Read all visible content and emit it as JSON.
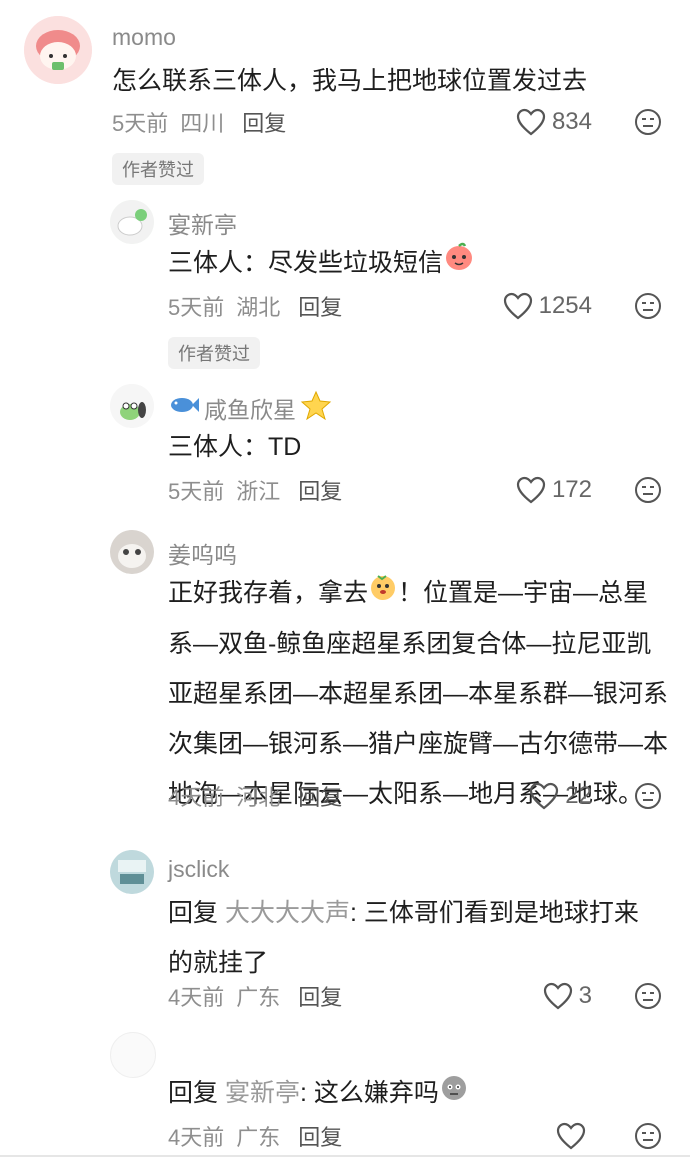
{
  "comments": [
    {
      "username": "momo",
      "text": "怎么联系三体人，我马上把地球位置发过去",
      "time": "5天前",
      "location": "四川",
      "reply_label": "回复",
      "likes": "834",
      "badge": "作者赞过"
    },
    {
      "username": "宴新亭",
      "text": "三体人：尽发些垃圾短信",
      "time": "5天前",
      "location": "湖北",
      "reply_label": "回复",
      "likes": "1254",
      "badge": "作者赞过"
    },
    {
      "username": "咸鱼欣星",
      "text": "三体人：TD",
      "time": "5天前",
      "location": "浙江",
      "reply_label": "回复",
      "likes": "172"
    },
    {
      "username": "姜呜呜",
      "text_before": "正好我存着，拿去",
      "text_after": "！位置是—宇宙—总星系—双鱼-鲸鱼座超星系团复合体—拉尼亚凯亚超星系团—本超星系团—本星系群—银河系次集团—银河系—猎户座旋臂—古尔德带—本地泡—本星际云—太阳系—地月系—地球。",
      "time": "4天前",
      "location": "河北",
      "reply_label": "回复",
      "likes": "22"
    },
    {
      "username": "jsclick",
      "reply_prefix": "回复",
      "reply_target": "大大大大声",
      "text": ": 三体哥们看到是地球打来的就挂了",
      "time": "4天前",
      "location": "广东",
      "reply_label": "回复",
      "likes": "3"
    },
    {
      "username": "",
      "reply_prefix": "回复",
      "reply_target": "宴新亭",
      "text": ": 这么嫌弃吗",
      "time": "4天前",
      "location": "广东",
      "reply_label": "回复",
      "likes": ""
    }
  ],
  "icons": {
    "like": "heart-outline-icon",
    "dislike": "unhappy-face-icon"
  },
  "colors": {
    "username": "#8a8a8a",
    "text": "#1e1e1e",
    "meta": "#8e8e8e",
    "badge_bg": "#f1f1f1"
  }
}
